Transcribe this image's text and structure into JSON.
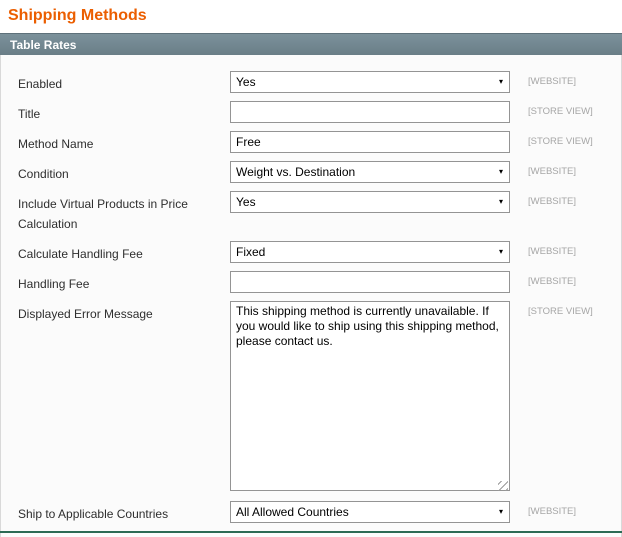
{
  "page": {
    "title": "Shipping Methods"
  },
  "section": {
    "title": "Table Rates"
  },
  "icons": {
    "dropdown_arrow": "▾"
  },
  "colors": {
    "page_title": "#eb5e00",
    "section_header_bg": "#6f8791",
    "scope_label": "#a6a6a6",
    "bottom_line": "#2c6b55"
  },
  "form": {
    "rows": [
      {
        "label": "Enabled",
        "type": "select",
        "value": "Yes",
        "scope": "[WEBSITE]"
      },
      {
        "label": "Title",
        "type": "text",
        "value": "",
        "scope": "[STORE VIEW]"
      },
      {
        "label": "Method Name",
        "type": "text",
        "value": "Free",
        "scope": "[STORE VIEW]"
      },
      {
        "label": "Condition",
        "type": "select",
        "value": "Weight vs. Destination",
        "scope": "[WEBSITE]"
      },
      {
        "label": "Include Virtual Products in Price Calculation",
        "type": "select",
        "value": "Yes",
        "scope": "[WEBSITE]"
      },
      {
        "label": "Calculate Handling Fee",
        "type": "select",
        "value": "Fixed",
        "scope": "[WEBSITE]"
      },
      {
        "label": "Handling Fee",
        "type": "text",
        "value": "",
        "scope": "[WEBSITE]"
      },
      {
        "label": "Displayed Error Message",
        "type": "textarea",
        "value": "This shipping method is currently unavailable. If you would like to ship using this shipping method, please contact us.",
        "scope": "[STORE VIEW]"
      },
      {
        "label": "Ship to Applicable Countries",
        "type": "select",
        "value": "All Allowed Countries",
        "scope": "[WEBSITE]"
      }
    ]
  }
}
